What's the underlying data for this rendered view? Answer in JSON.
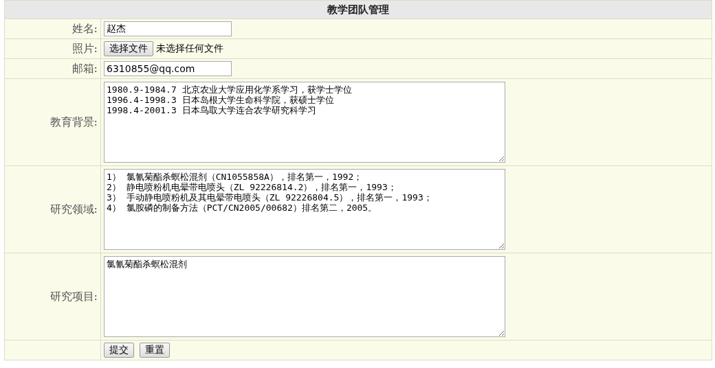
{
  "title": "教学团队管理",
  "fields": [
    {
      "kind": "text",
      "label": "姓名:",
      "value": "赵杰"
    },
    {
      "kind": "file",
      "label": "照片:",
      "button": "选择文件",
      "status": "未选择任何文件"
    },
    {
      "kind": "text",
      "label": "邮箱:",
      "value": "6310855@qq.com"
    },
    {
      "kind": "textarea",
      "label": "教育背景:",
      "value": "1980.9-1984.7 北京农业大学应用化学系学习，获学士学位\n1996.4-1998.3 日本岛根大学生命科学院，获硕士学位\n1998.4-2001.3 日本鸟取大学连合农学研究科学习"
    },
    {
      "kind": "textarea",
      "label": "研究领域:",
      "value": "1） 氯氰菊酯杀螟松混剂（CN1055858A），排名第一，1992；\n2） 静电喷粉机电晕带电喷头（ZL 92226814.2），排名第一，1993；\n3） 手动静电喷粉机及其电晕带电喷头（ZL 92226804.5），排名第一，1993；\n4） 氯胺磷的制备方法（PCT/CN2005/00682）排名第二，2005。"
    },
    {
      "kind": "textarea",
      "label": "研究项目:",
      "value": "氯氰菊酯杀螟松混剂"
    }
  ],
  "buttons": [
    "提交",
    "重置"
  ]
}
